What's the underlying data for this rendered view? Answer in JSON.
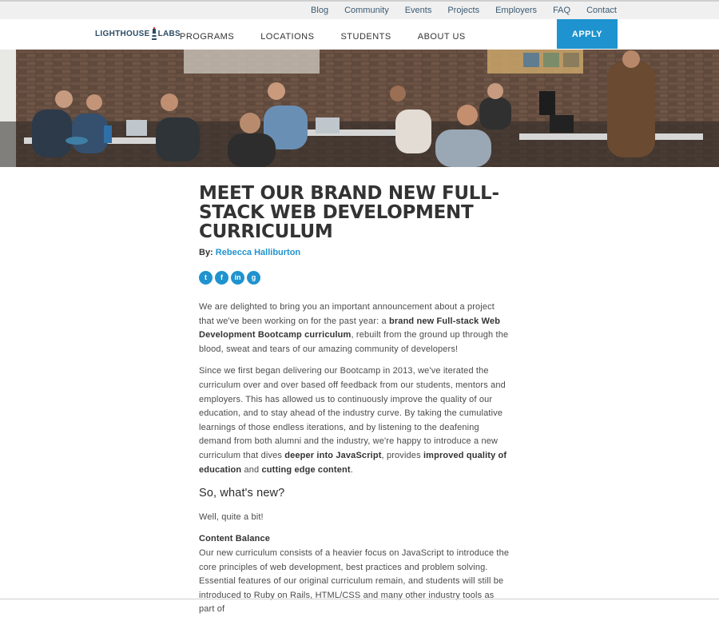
{
  "utility_nav": [
    "Blog",
    "Community",
    "Events",
    "Projects",
    "Employers",
    "FAQ",
    "Contact"
  ],
  "logo": {
    "left": "LIGHTHOUSE",
    "right": "LABS"
  },
  "main_nav": [
    "PROGRAMS",
    "LOCATIONS",
    "STUDENTS",
    "ABOUT US"
  ],
  "apply_label": "APPLY",
  "article": {
    "title": "MEET OUR BRAND NEW FULL-STACK WEB DEVELOPMENT CURRICULUM",
    "by_label": "By:",
    "author": "Rebecca Halliburton",
    "share_icons": [
      "twitter-icon",
      "facebook-icon",
      "linkedin-icon",
      "google-plus-icon"
    ],
    "share_glyphs": [
      "t",
      "f",
      "in",
      "g"
    ],
    "p1": {
      "a": "We are delighted to bring you an important announcement about a project that we've been working on for the past year: a ",
      "b": "brand new Full-stack Web Development Bootcamp curriculum",
      "c": ", rebuilt from the ground up through the blood, sweat and tears of our amazing community of developers!"
    },
    "p2": {
      "a": "Since we first began delivering our Bootcamp in 2013, we've iterated the curriculum over and over based off feedback from our students, mentors and employers. This has allowed us to continuously improve the quality of our education, and to stay ahead of the industry curve. By taking the cumulative learnings of those endless iterations, and by listening to the deafening demand from both alumni and the industry, we're happy to introduce a new curriculum that dives ",
      "b": "deeper into JavaScript",
      "c": ", provides ",
      "d": "improved quality of education",
      "e": " and ",
      "f": "cutting edge content",
      "g": "."
    },
    "heading": "So, what's new?",
    "p3": "Well, quite a bit!",
    "subheading": "Content Balance",
    "p4": "Our new curriculum consists of a heavier focus on JavaScript to introduce the core principles of web development, best practices and problem solving. Essential features of our original curriculum remain, and students will still be introduced to Ruby on Rails, HTML/CSS and many other industry tools as part of"
  },
  "colors": {
    "accent": "#1f93cf",
    "utility_bg": "#f0f0f0",
    "logo": "#2b4c66"
  }
}
